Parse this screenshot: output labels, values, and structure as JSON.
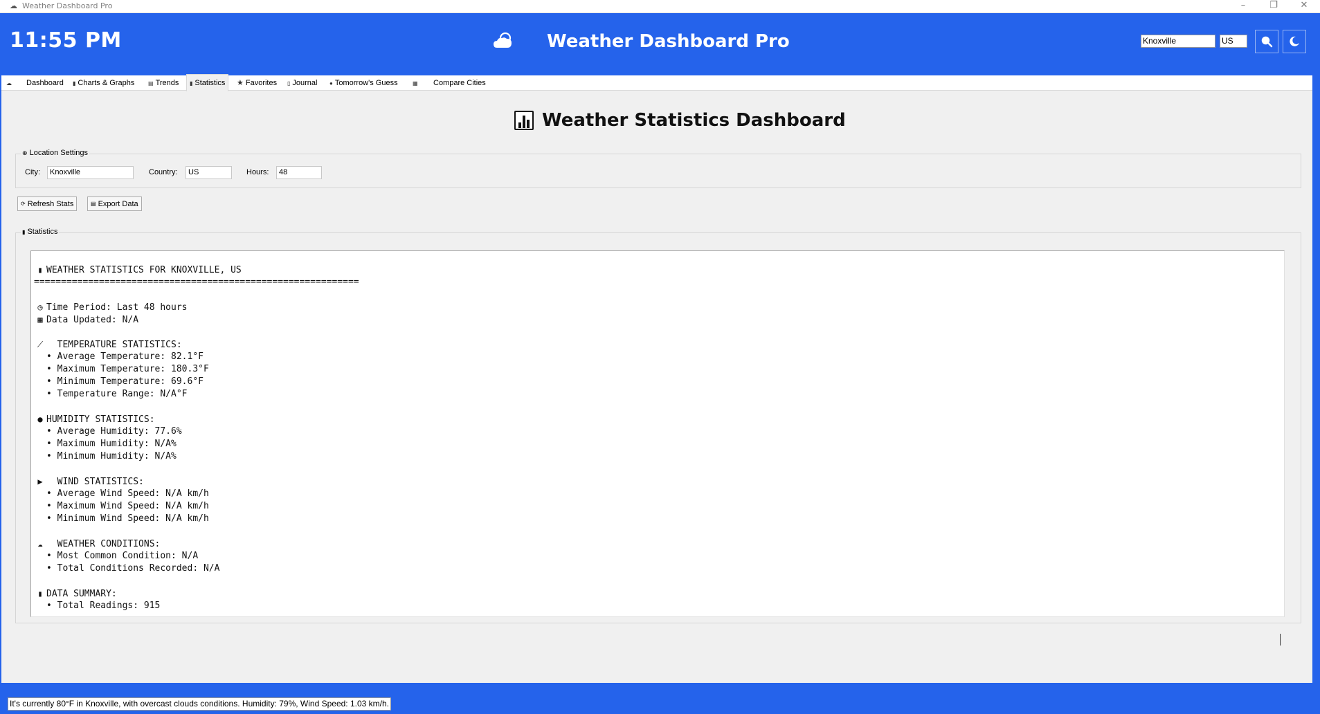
{
  "window": {
    "title": "Weather Dashboard Pro"
  },
  "header": {
    "time": "11:55 PM",
    "title": "Weather Dashboard Pro",
    "city_value": "Knoxville",
    "country_value": "US",
    "search_icon": "search-icon",
    "theme_icon": "moon-icon"
  },
  "tabs": [
    {
      "label": "Dashboard",
      "icon": "cloud-icon"
    },
    {
      "label": "Charts & Graphs",
      "icon": "bar-chart-icon"
    },
    {
      "label": "Trends",
      "icon": "trend-icon"
    },
    {
      "label": "Statistics",
      "icon": "bar-chart-icon",
      "active": true
    },
    {
      "label": "Favorites",
      "icon": "star-icon"
    },
    {
      "label": "Journal",
      "icon": "journal-icon"
    },
    {
      "label": "Tomorrow's Guess",
      "icon": "crystal-ball-icon"
    },
    {
      "label": "Compare Cities",
      "icon": "compare-icon"
    }
  ],
  "page": {
    "heading": "Weather Statistics Dashboard"
  },
  "location_settings": {
    "label": "Location Settings",
    "city_label": "City:",
    "city_value": "Knoxville",
    "country_label": "Country:",
    "country_value": "US",
    "hours_label": "Hours:",
    "hours_value": "48"
  },
  "actions": {
    "refresh_label": "Refresh Stats",
    "export_label": "Export Data"
  },
  "statistics": {
    "label": "Statistics",
    "lines": [
      {
        "icon": "bar-chart-icon",
        "text": "WEATHER STATISTICS FOR KNOXVILLE, US"
      },
      {
        "icon": "",
        "text": "============================================================"
      },
      {
        "icon": "",
        "text": ""
      },
      {
        "icon": "clock-icon",
        "text": "Time Period: Last 48 hours"
      },
      {
        "icon": "calendar-icon",
        "text": "Data Updated: N/A"
      },
      {
        "icon": "",
        "text": ""
      },
      {
        "icon": "thermometer-icon",
        "text": "  TEMPERATURE STATISTICS:"
      },
      {
        "icon": "",
        "text": "• Average Temperature: 82.1°F"
      },
      {
        "icon": "",
        "text": "• Maximum Temperature: 180.3°F"
      },
      {
        "icon": "",
        "text": "• Minimum Temperature: 69.6°F"
      },
      {
        "icon": "",
        "text": "• Temperature Range: N/A°F"
      },
      {
        "icon": "",
        "text": ""
      },
      {
        "icon": "droplet-icon",
        "text": "HUMIDITY STATISTICS:"
      },
      {
        "icon": "",
        "text": "• Average Humidity: 77.6%"
      },
      {
        "icon": "",
        "text": "• Maximum Humidity: N/A%"
      },
      {
        "icon": "",
        "text": "• Minimum Humidity: N/A%"
      },
      {
        "icon": "",
        "text": ""
      },
      {
        "icon": "wind-icon",
        "text": "  WIND STATISTICS:"
      },
      {
        "icon": "",
        "text": "• Average Wind Speed: N/A km/h"
      },
      {
        "icon": "",
        "text": "• Maximum Wind Speed: N/A km/h"
      },
      {
        "icon": "",
        "text": "• Minimum Wind Speed: N/A km/h"
      },
      {
        "icon": "",
        "text": ""
      },
      {
        "icon": "cloud-icon",
        "text": "  WEATHER CONDITIONS:"
      },
      {
        "icon": "",
        "text": "• Most Common Condition: N/A"
      },
      {
        "icon": "",
        "text": "• Total Conditions Recorded: N/A"
      },
      {
        "icon": "",
        "text": ""
      },
      {
        "icon": "bar-chart-icon",
        "text": "DATA SUMMARY:"
      },
      {
        "icon": "",
        "text": "• Total Readings: 915"
      }
    ]
  },
  "status": {
    "text": "It's currently 80°F in Knoxville, with overcast clouds conditions. Humidity: 79%, Wind Speed: 1.03 km/h."
  },
  "colors": {
    "accent": "#2563eb",
    "panel": "#f0f0f0"
  }
}
